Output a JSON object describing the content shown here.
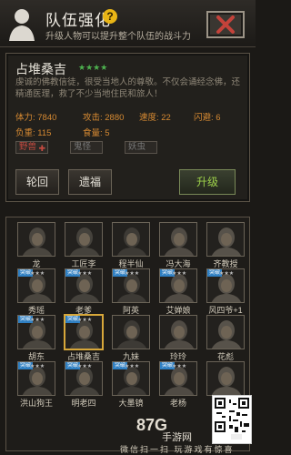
{
  "header": {
    "title": "队伍强化",
    "subtitle": "升级人物可以提升整个队伍的战斗力"
  },
  "hero": {
    "name": "占堆桑吉",
    "stars": "★★★★",
    "description": "虔诚的佛教信徒，很受当地人的尊敬。不仅会诵经念佛，还精通医理，救了不少当地住民和旅人！",
    "stats": {
      "hp": "体力: 7840",
      "atk": "攻击: 2880",
      "spd": "速度: 22",
      "dodge": "闪避: 6",
      "load": "负重: 115",
      "food": "食量: 5"
    },
    "tags": [
      {
        "label": "野兽",
        "active": true
      },
      {
        "label": "鬼怪",
        "active": false
      },
      {
        "label": "妖虫",
        "active": false
      }
    ]
  },
  "buttons": {
    "reincarnate": "轮回",
    "bequest": "遗福",
    "upgrade": "升级"
  },
  "roster": [
    {
      "name": "龙",
      "badge": "",
      "selected": false
    },
    {
      "name": "工匠李",
      "badge": "",
      "selected": false
    },
    {
      "name": "程半仙",
      "badge": "",
      "selected": false
    },
    {
      "name": "冯大海",
      "badge": "",
      "selected": false
    },
    {
      "name": "齐教授",
      "badge": "",
      "selected": false
    },
    {
      "name": "秀瑶",
      "badge": "突破",
      "selected": false
    },
    {
      "name": "老爹",
      "badge": "突破",
      "selected": false
    },
    {
      "name": "阿英",
      "badge": "突破",
      "selected": false
    },
    {
      "name": "艾婵娘",
      "badge": "突破",
      "selected": false
    },
    {
      "name": "风四爷+1",
      "badge": "突破",
      "selected": false
    },
    {
      "name": "胡东",
      "badge": "突破",
      "selected": false
    },
    {
      "name": "占堆桑吉",
      "badge": "突破",
      "selected": true
    },
    {
      "name": "九妹",
      "badge": "",
      "selected": false
    },
    {
      "name": "玲玲",
      "badge": "",
      "selected": false
    },
    {
      "name": "花彪",
      "badge": "",
      "selected": false
    },
    {
      "name": "洪山狗王",
      "badge": "突破",
      "selected": false
    },
    {
      "name": "明老四",
      "badge": "突破",
      "selected": false
    },
    {
      "name": "大墨镜",
      "badge": "突破",
      "selected": false
    },
    {
      "name": "老杨",
      "badge": "突破",
      "selected": false
    },
    {
      "name": "",
      "badge": "",
      "selected": false
    }
  ],
  "watermark": {
    "logo": "87G",
    "site": "手游网",
    "caption": "微信扫一扫 玩游戏有惊喜"
  }
}
